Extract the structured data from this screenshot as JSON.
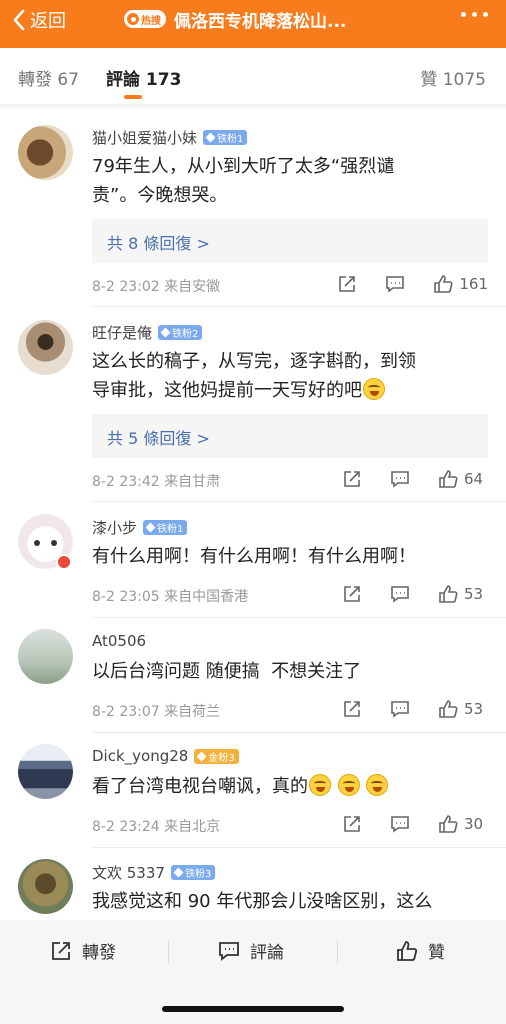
{
  "header": {
    "back_label": "返回",
    "hot_badge": "热搜",
    "title": "佩洛西专机降落松山..."
  },
  "tabs": {
    "repost": "轉發 67",
    "comments": "評論 173",
    "likes": "贊 1075"
  },
  "comments": [
    {
      "user": "猫小姐爱猫小妹",
      "badge": "铁粉1",
      "text_lines": [
        "79年生人，从小到大听了太多“强烈谴",
        "责”。今晚想哭。"
      ],
      "replies": "共 8 條回復 >",
      "meta": "8-2 23:02  来自安徽",
      "likes": "161"
    },
    {
      "user": "旺仔是俺",
      "badge": "铁粉2",
      "text_lines": [
        "这么长的稿子，从写完，逐字斟酌，到领",
        "导审批，这他妈提前一天写好的吧"
      ],
      "replies": "共 5 條回復 >",
      "meta": "8-2 23:42  来自甘肃",
      "likes": "64"
    },
    {
      "user": "漆小步",
      "badge": "铁粉1",
      "text_lines": [
        "有什么用啊！有什么用啊！有什么用啊！"
      ],
      "meta": "8-2 23:05  来自中国香港",
      "likes": "53"
    },
    {
      "user": "At0506",
      "text_lines": [
        "以后台湾问题 随便搞  不想关注了"
      ],
      "meta": "8-2 23:07  来自荷兰",
      "likes": "53"
    },
    {
      "user": "Dick_yong28",
      "badge": "金粉3",
      "text_lines": [
        "看了台湾电视台嘲讽，真的"
      ],
      "meta": "8-2 23:24  来自北京",
      "likes": "30"
    },
    {
      "user": "文欢 5337",
      "badge": "铁粉3",
      "text_lines": [
        "我感觉这和 90 年代那会儿没啥区别，这么"
      ]
    }
  ],
  "bottom_bar": {
    "repost": "轉發",
    "comment": "評論",
    "like": "贊"
  },
  "colors": {
    "accent": "#f97c1c",
    "link": "#4b6fae",
    "fan_badge": "#7aa9ee",
    "gold_badge": "#f3b13b"
  }
}
